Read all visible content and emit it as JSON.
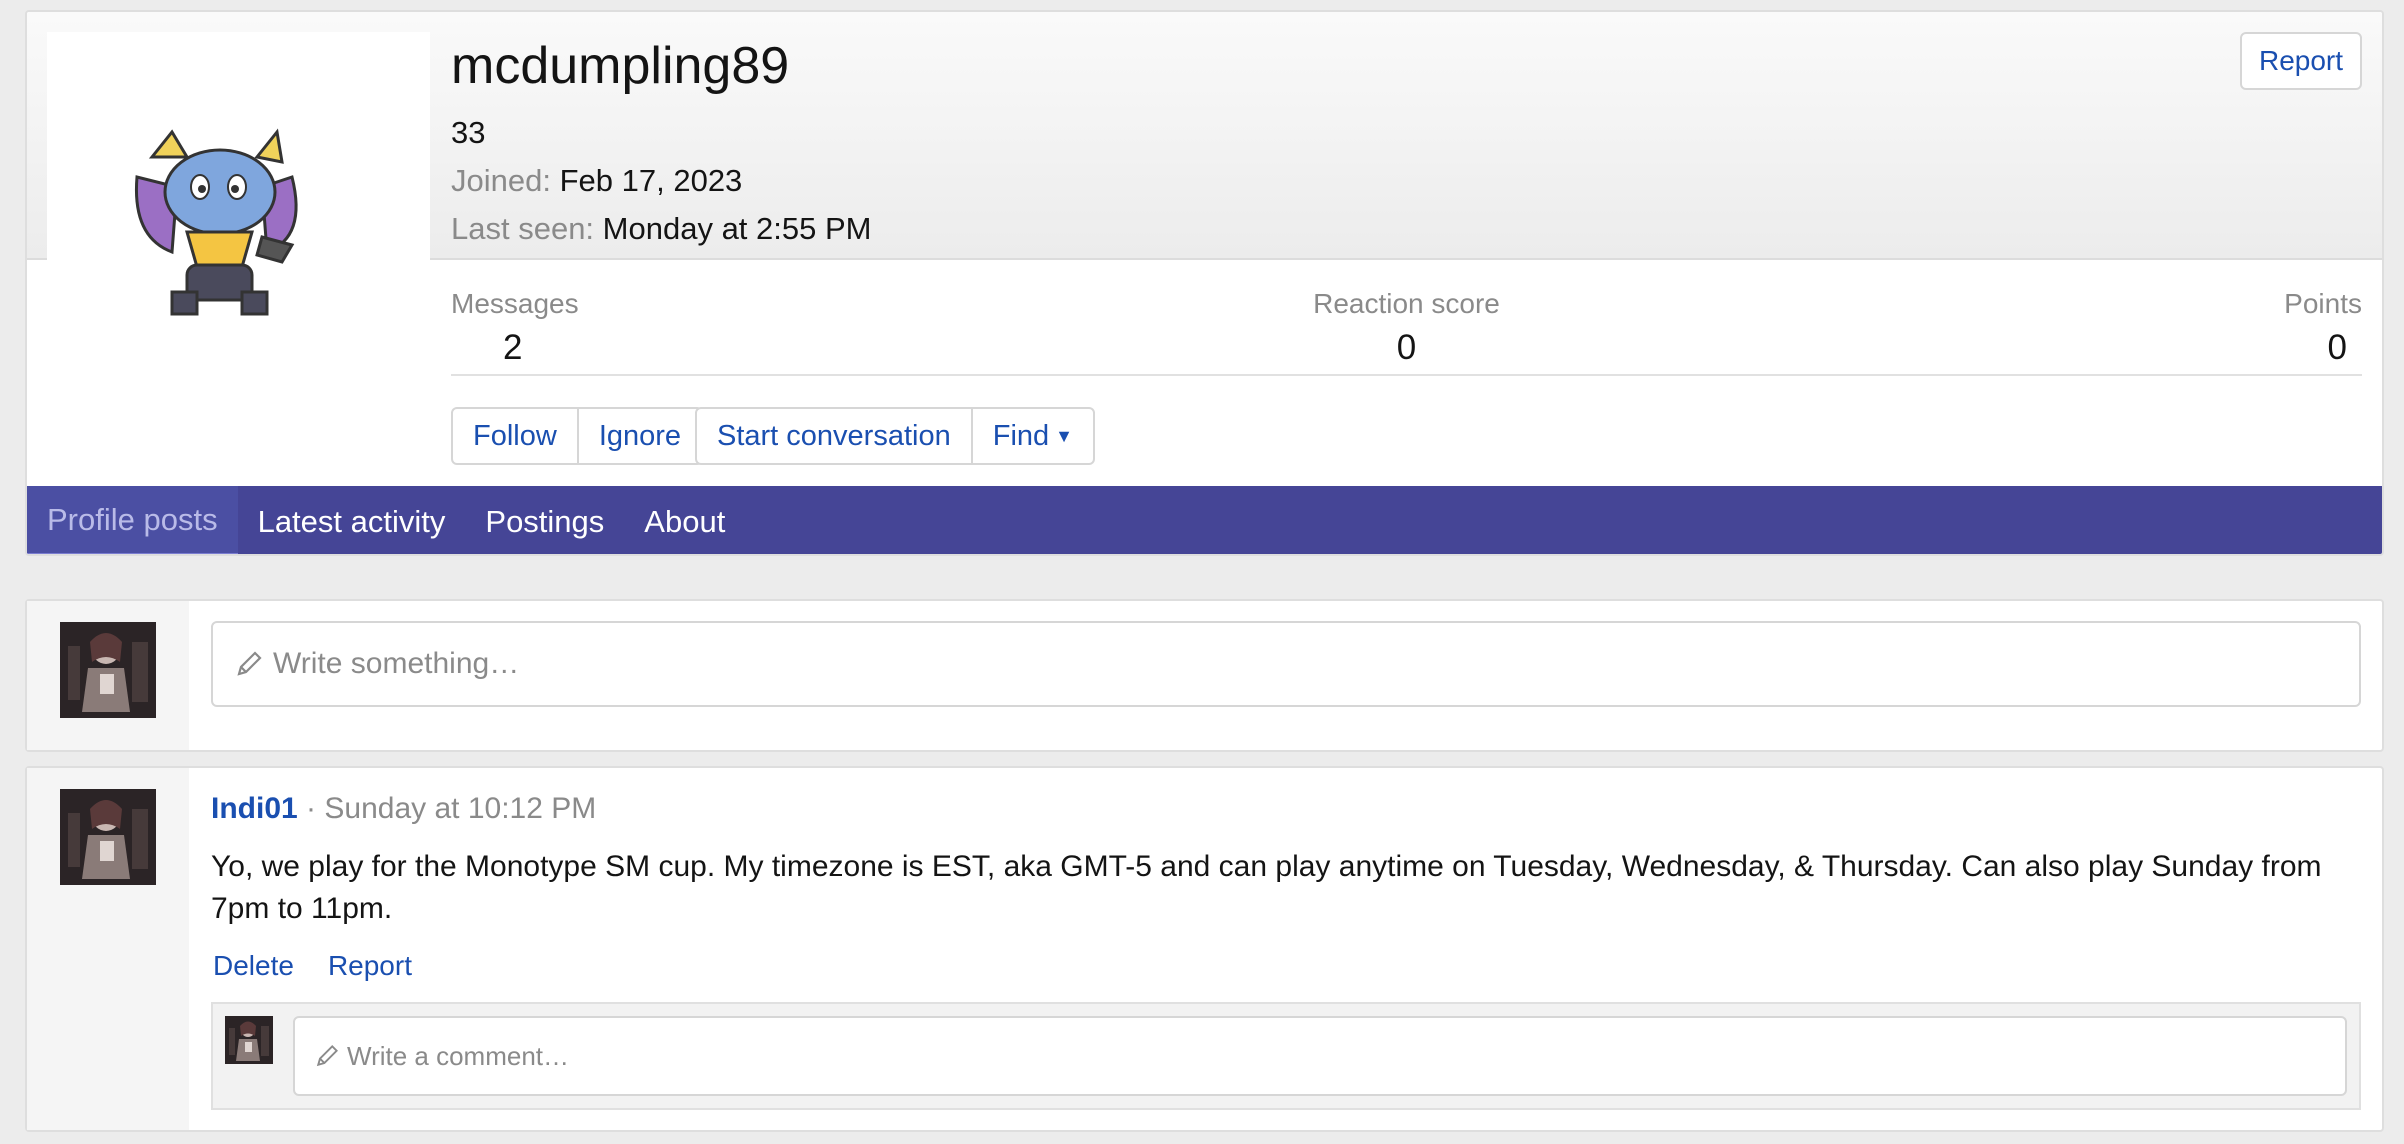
{
  "profile": {
    "username": "mcdumpling89",
    "title": "33",
    "joined_label": "Joined:",
    "joined_value": "Feb 17, 2023",
    "last_seen_label": "Last seen:",
    "last_seen_value": "Monday at 2:55 PM",
    "report_label": "Report",
    "stats": [
      {
        "label": "Messages",
        "value": "2"
      },
      {
        "label": "Reaction score",
        "value": "0"
      },
      {
        "label": "Points",
        "value": "0"
      }
    ],
    "buttons": {
      "follow": "Follow",
      "ignore": "Ignore",
      "start_conversation": "Start conversation",
      "find": "Find"
    }
  },
  "tabs": [
    {
      "label": "Profile posts",
      "active": true
    },
    {
      "label": "Latest activity",
      "active": false
    },
    {
      "label": "Postings",
      "active": false
    },
    {
      "label": "About",
      "active": false
    }
  ],
  "new_post": {
    "placeholder": "Write something…"
  },
  "posts": [
    {
      "author": "Indi01",
      "separator": "·",
      "time": "Sunday at 10:12 PM",
      "body": "Yo, we play for the Monotype SM cup. My timezone is EST, aka GMT-5 and can play anytime on Tuesday, Wednesday, & Thursday. Can also play Sunday from 7pm to 11pm.",
      "actions": {
        "delete": "Delete",
        "report": "Report"
      },
      "comment_placeholder": "Write a comment…"
    }
  ],
  "colors": {
    "tab_bar": "#454596",
    "link": "#1a4fb0",
    "muted": "#8a8a8a"
  },
  "icons": [
    "pencil-icon",
    "caret-down-icon"
  ]
}
